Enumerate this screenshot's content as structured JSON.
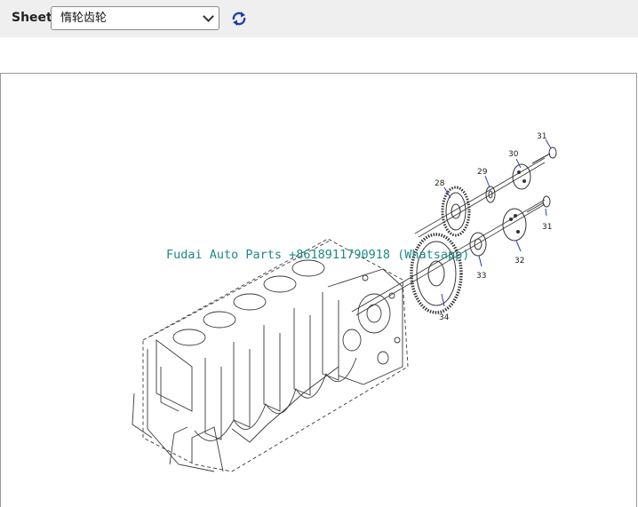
{
  "toolbar": {
    "sheet_label": "Sheet",
    "sheet_selected": "惰轮齿轮",
    "refresh_icon": "refresh-icon"
  },
  "viewer": {
    "watermark": "Fudai Auto Parts +8618911790918 (Whatsapp)",
    "callouts": {
      "c28": "28",
      "c29": "29",
      "c30": "30",
      "c31a": "31",
      "c31b": "31",
      "c32": "32",
      "c33": "33",
      "c34": "34"
    }
  }
}
